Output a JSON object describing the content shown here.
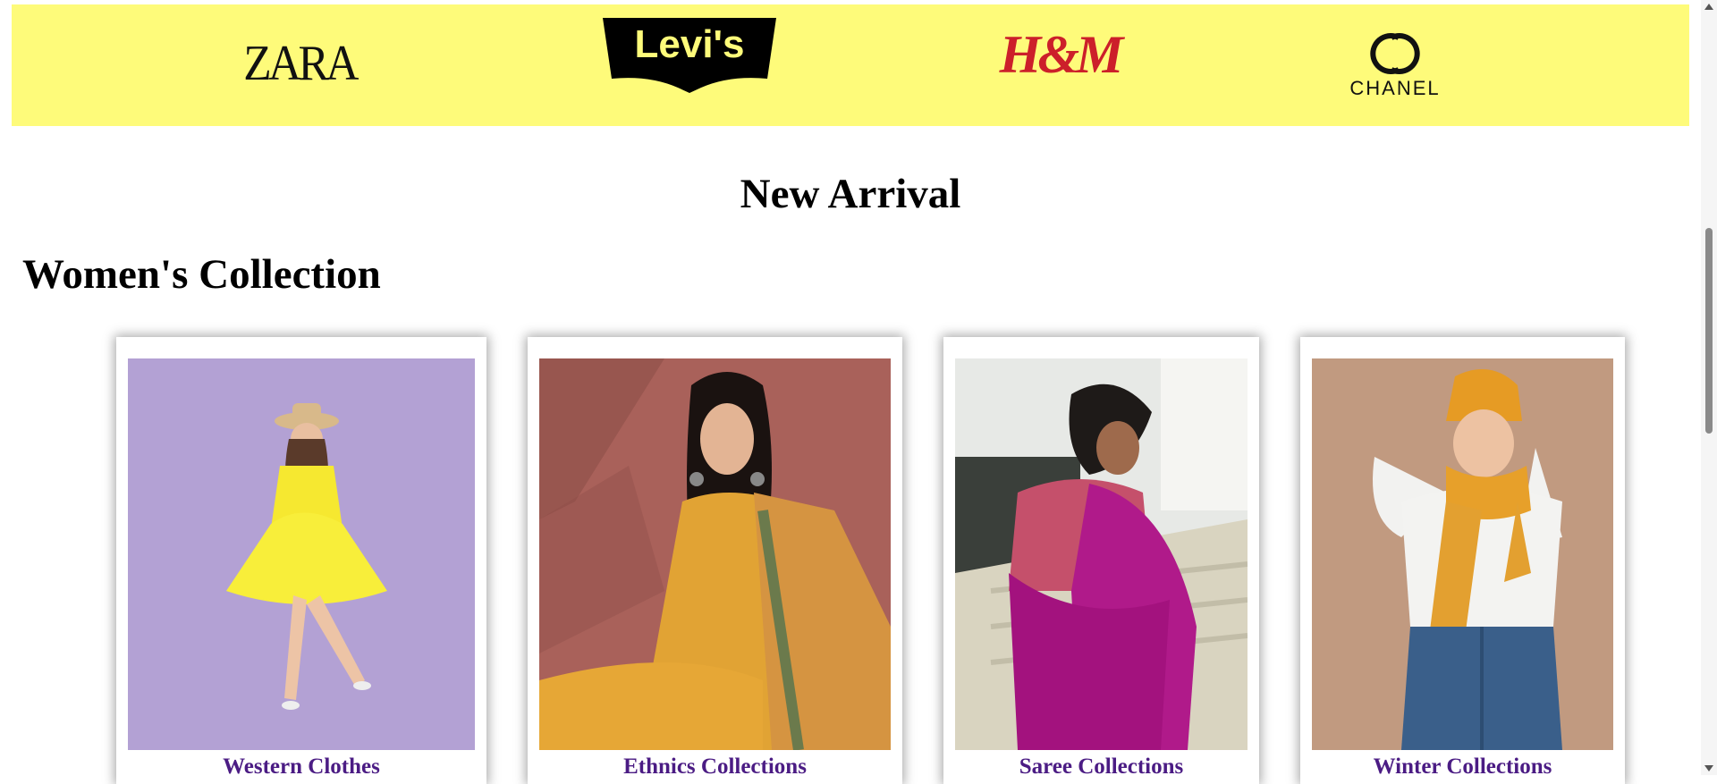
{
  "brands": {
    "zara": "ZARA",
    "levis": "Levi's",
    "hm": "H&M",
    "chanel": "CHANEL"
  },
  "heading": "New Arrival",
  "section": "Women's Collection",
  "cards": [
    {
      "label": "Western Clothes"
    },
    {
      "label": "Ethnics Collections"
    },
    {
      "label": "Saree Collections"
    },
    {
      "label": "Winter Collections"
    }
  ],
  "colors": {
    "banner": "#fefb7a",
    "caption": "#4b1c84"
  }
}
